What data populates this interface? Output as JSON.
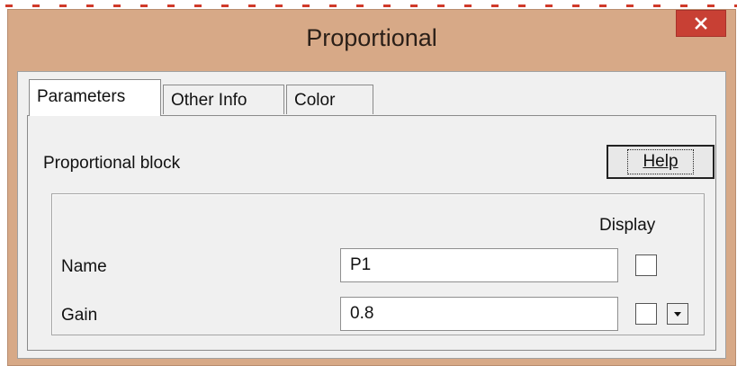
{
  "window": {
    "title": "Proportional",
    "close_icon": "close-icon",
    "accent_color": "#d7a987",
    "close_color": "#c84034"
  },
  "tabs": [
    {
      "label": "Parameters",
      "active": true
    },
    {
      "label": "Other Info",
      "active": false
    },
    {
      "label": "Color",
      "active": false
    }
  ],
  "panel": {
    "block_label": "Proportional block",
    "help_label": "Help",
    "display_header": "Display",
    "rows": [
      {
        "label": "Name",
        "value": "P1",
        "display_checked": false
      },
      {
        "label": "Gain",
        "value": "0.8",
        "display_checked": false,
        "has_dropdown": true
      }
    ],
    "dropdown_icon": "chevron-down-icon"
  }
}
